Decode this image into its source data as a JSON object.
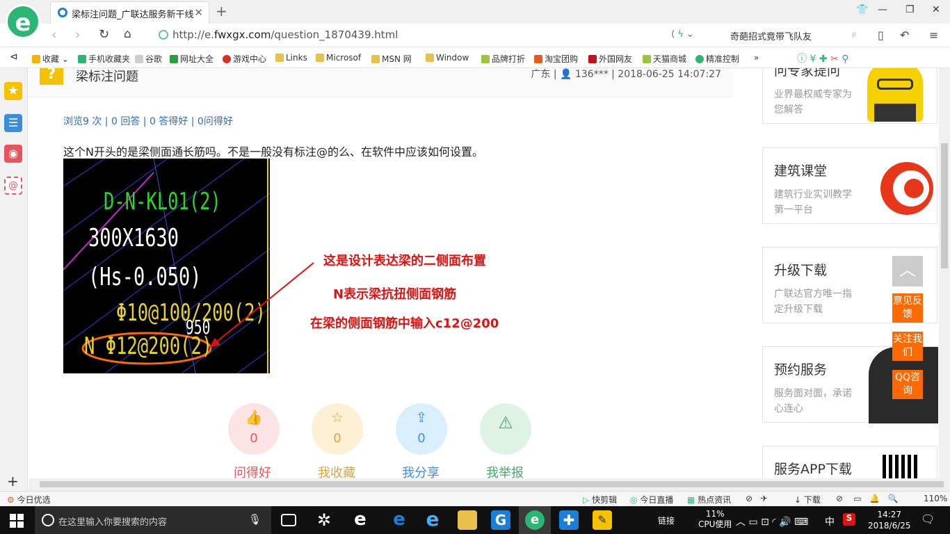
{
  "browser": {
    "tab_title": "梁标注问题_广联达服务新干线",
    "url_prefix": "http://e.",
    "url_domain": "fwxgx.com",
    "url_path": "/question_1870439.html",
    "search_text": "奇葩招式竟带飞队友"
  },
  "bookmarks": [
    {
      "label": "收藏",
      "color": "#f4b400"
    },
    {
      "label": "手机收藏夹",
      "color": "#2bb673"
    },
    {
      "label": "谷歌",
      "color": "#bbbbbb"
    },
    {
      "label": "网址大全",
      "color": "#2a9d3f"
    },
    {
      "label": "游戏中心",
      "color": "#d9301f"
    },
    {
      "label": "Links",
      "color": "#e8c14a"
    },
    {
      "label": "Microsof",
      "color": "#e8c14a"
    },
    {
      "label": "MSN 网",
      "color": "#e8c14a"
    },
    {
      "label": "Window",
      "color": "#e8c14a"
    },
    {
      "label": "品牌打折",
      "color": "#9ac43c"
    },
    {
      "label": "淘宝团购",
      "color": "#e85a1b"
    },
    {
      "label": "外国网友",
      "color": "#c4121b"
    },
    {
      "label": "天猫商城",
      "color": "#9ac43c"
    },
    {
      "label": "精准控制",
      "color": "#2bb673"
    }
  ],
  "question": {
    "title": "梁标注问题",
    "meta": "广东 | 👤 136*** | 2018-06-25 14:07:27",
    "stats": "浏览9 次 | 0 回答 | 0 答得好 | 0问得好",
    "body": "这个N开头的是梁侧面通长筋吗。不是一般没有标注@的么、在软件中应该如何设置。",
    "cad_lines": [
      "D-N-KL01(2)",
      "300X1630",
      "(Hs-0.050)",
      "Φ10@100/200(2)",
      "N Φ12@200(2)",
      "950"
    ],
    "annotations": [
      "这是设计表达梁的二侧面布置",
      "N表示梁抗扭侧面钢筋",
      "在梁的侧面钢筋中输入c12@200"
    ]
  },
  "actions": [
    {
      "label": "问得好",
      "count": "0",
      "icon": "thumb-up-icon",
      "glyph": "👍",
      "bg": "#fde4e4",
      "fg": "#e8545b"
    },
    {
      "label": "我收藏",
      "count": "0",
      "icon": "star-icon",
      "glyph": "☆",
      "bg": "#fdf0d4",
      "fg": "#d9a441"
    },
    {
      "label": "我分享",
      "count": "0",
      "icon": "share-icon",
      "glyph": "⇪",
      "bg": "#daeffc",
      "fg": "#3c8fd6"
    },
    {
      "label": "我举报",
      "count": "",
      "icon": "warning-icon",
      "glyph": "⚠",
      "bg": "#dff3e4",
      "fg": "#48a86a"
    }
  ],
  "right_cards": [
    {
      "title": "问专家提问",
      "desc": "业界最权威专家为您解答"
    },
    {
      "title": "建筑课堂",
      "desc": "建筑行业实训教学第一平台"
    },
    {
      "title": "升级下载",
      "desc": "广联达官方唯一指定升级下载"
    },
    {
      "title": "预约服务",
      "desc": "服务面对面，承诺心连心"
    },
    {
      "title": "服务APP下载",
      "desc": ""
    }
  ],
  "floating": [
    {
      "label": "意见反馈"
    },
    {
      "label": "关注我们"
    },
    {
      "label": "QQ咨询"
    }
  ],
  "statusbar": {
    "left": "今日优选",
    "items": [
      "快剪辑",
      "今日直播",
      "热点资讯",
      "下载"
    ],
    "zoom": "110%"
  },
  "taskbar": {
    "search_placeholder": "在这里输入你要搜索的内容",
    "link_label": "链接",
    "cpu": "11%",
    "cpu_label": "CPU使用",
    "ime": "中",
    "time": "14:27",
    "date": "2018/6/25"
  }
}
